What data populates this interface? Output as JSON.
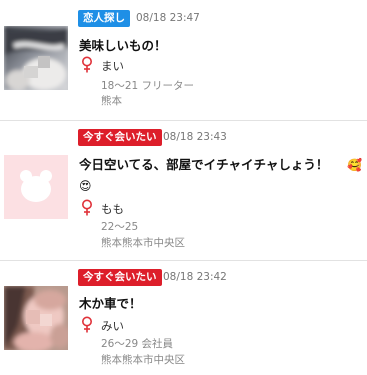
{
  "posts": [
    {
      "badge": "恋人探し",
      "badge_color": "#1e8fe6",
      "time": "08/18 23:47",
      "title": "美味しいもの！",
      "gender_icon": "venus-icon",
      "name": "まい",
      "age_job": "18～21 フリーター",
      "area": "熊本",
      "thumbnail": "blurred-profile-photo"
    },
    {
      "badge": "今すぐ会いたい",
      "badge_color": "#dd1e2a",
      "time": "08/18 23:43",
      "title": "今日空いてる、部屋でイチャイチャしょう！",
      "title_emoji": "🥰",
      "title_emoji2": "😍",
      "gender_icon": "venus-icon",
      "name": "もも",
      "age_job": "22～25",
      "area": "熊本熊本市中央区",
      "thumbnail": "default-bear-avatar"
    },
    {
      "badge": "今すぐ会いたい",
      "badge_color": "#dd1e2a",
      "time": "08/18 23:42",
      "title": "木か車で！",
      "gender_icon": "venus-icon",
      "name": "みい",
      "age_job": "26～29 会社員",
      "area": "熊本熊本市中央区",
      "thumbnail": "blurred-profile-photo"
    }
  ]
}
